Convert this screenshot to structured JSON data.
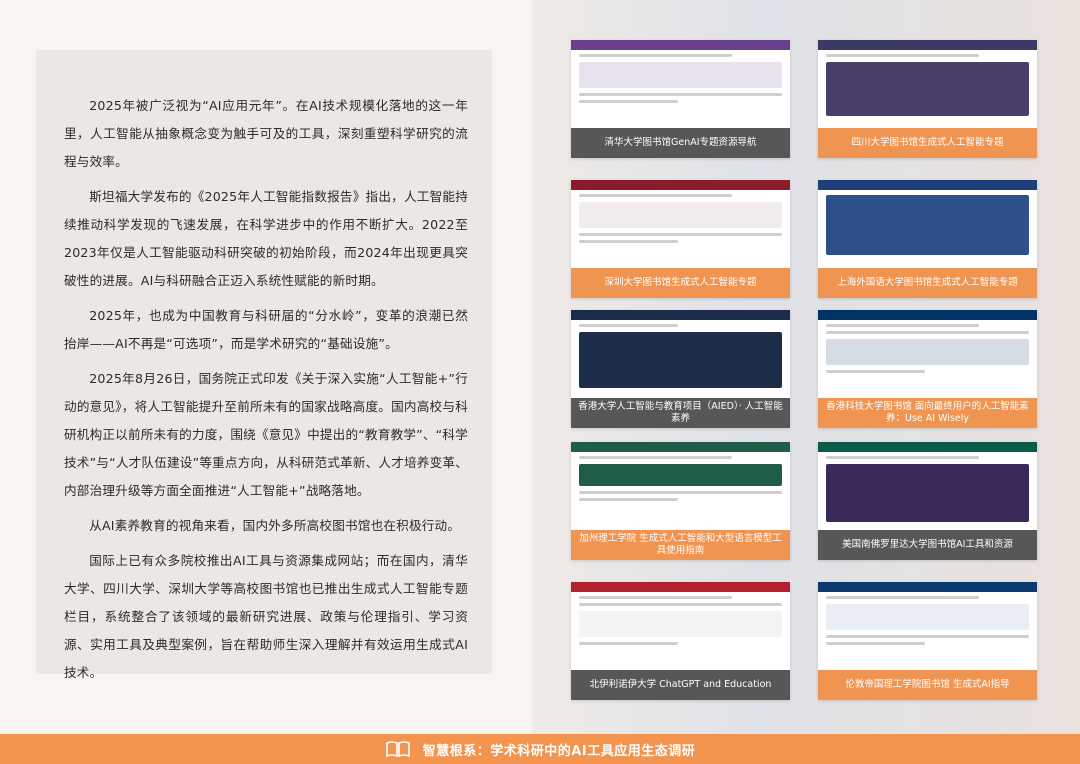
{
  "article": {
    "paragraphs": [
      "2025年被广泛视为“AI应用元年”。在AI技术规模化落地的这一年里，人工智能从抽象概念变为触手可及的工具，深刻重塑科学研究的流程与效率。",
      "斯坦福大学发布的《2025年人工智能指数报告》指出，人工智能持续推动科学发现的飞速发展，在科学进步中的作用不断扩大。2022至2023年仅是人工智能驱动科研突破的初始阶段，而2024年出现更具突破性的进展。AI与科研融合正迈入系统性赋能的新时期。",
      "2025年，也成为中国教育与科研届的“分水岭”，变革的浪潮已然抬岸——AI不再是“可选项”，而是学术研究的“基础设施”。",
      "2025年8月26日，国务院正式印发《关于深入实施“人工智能+”行动的意见》，将人工智能提升至前所未有的国家战略高度。国内高校与科研机构正以前所未有的力度，围绕《意见》中提出的“教育教学”、“科学技术”与“人才队伍建设”等重点方向，从科研范式革新、人才培养变革、内部治理升级等方面全面推进“人工智能+”战略落地。",
      "从AI素养教育的视角来看，国内外多所高校图书馆也在积极行动。",
      "国际上已有众多院校推出AI工具与资源集成网站；而在国内，清华大学、四川大学、深圳大学等高校图书馆也已推出生成式人工智能专题栏目，系统整合了该领域的最新研究进展、政策与伦理指引、学习资源、实用工具及典型案例，旨在帮助师生深入理解并有效运用生成式AI技术。"
    ]
  },
  "tiles": [
    {
      "caption": "清华大学图书馆GenAI专题资源导航",
      "style": "dark",
      "accent": "#6b3e8e"
    },
    {
      "caption": "四川大学图书馆生成式人工智能专题",
      "style": "orange",
      "accent": "#3b3a66"
    },
    {
      "caption": "深圳大学图书馆生成式人工智能专题",
      "style": "orange",
      "accent": "#8b1c2c"
    },
    {
      "caption": "上海外国语大学图书馆生成式人工智能专题",
      "style": "orange",
      "accent": "#1f3f7a"
    },
    {
      "caption": "香港大学人工智能与教育项目（AIED）· 人工智能素养",
      "style": "dark",
      "accent": "#1c2c4a"
    },
    {
      "caption": "香港科技大学图书馆 面向最终用户的人工智能素养：Use AI Wisely",
      "style": "orange",
      "accent": "#003366"
    },
    {
      "caption": "加州理工学院 生成式人工智能和大型语言模型工具使用指南",
      "style": "orange",
      "accent": "#1f5c4a"
    },
    {
      "caption": "美国南佛罗里达大学图书馆AI工具和资源",
      "style": "dark",
      "accent": "#0b5b4a"
    },
    {
      "caption": "北伊利诺伊大学 ChatGPT and Education",
      "style": "dark",
      "accent": "#b3212f"
    },
    {
      "caption": "伦敦帝国理工学院图书馆 生成式AI指导",
      "style": "orange",
      "accent": "#0b3a6e"
    }
  ],
  "footer": {
    "icon": "book-icon",
    "title": "智慧根系：学术科研中的AI工具应用生态调研"
  }
}
